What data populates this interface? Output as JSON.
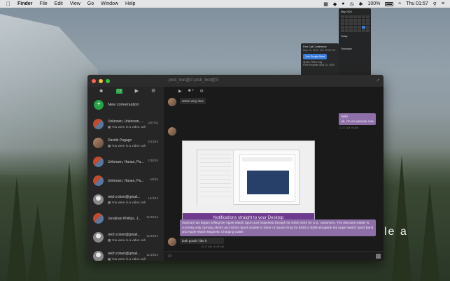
{
  "menubar": {
    "apple": "",
    "app_name": "Finder",
    "menus": [
      "File",
      "Edit",
      "View",
      "Go",
      "Window",
      "Help"
    ],
    "battery": "100%",
    "clock": "Thu 01:57"
  },
  "notification": {
    "title": "First Call Conference",
    "time": "May 22, 2020, 15 • 10:00 PM",
    "join_label": "Join Google Meet",
    "line1": "Sprint: Retro Day",
    "line2": "First Request: May 24, 2020"
  },
  "calendar": {
    "month": "May 2020",
    "today_label": "Today",
    "tomorrow_label": "Tomorrow"
  },
  "window": {
    "title": "pick_bot@3 pick_bot@3"
  },
  "sidebar": {
    "new_conversation": "New conversation",
    "conversations": [
      {
        "name": "Unknown, Unknown, ...",
        "sub": "You were in a video call",
        "time": "2/27/15"
      },
      {
        "name": "Davide Pagago",
        "sub": "You were in a video call",
        "time": "2/13/15"
      },
      {
        "name": "Unknown, Hanan, Pa...",
        "sub": "",
        "time": "1/30/15"
      },
      {
        "name": "Unknown, Hanan, Pa...",
        "sub": "",
        "time": "1/6/15"
      },
      {
        "name": "reich.robert@gmail...",
        "sub": "You were in a video call",
        "time": "12/4/14"
      },
      {
        "name": "Jonathan Phillips, J...",
        "sub": "",
        "time": "11/26/14"
      },
      {
        "name": "reich.robert@gmail...",
        "sub": "You were in a video call",
        "time": "11/20/14"
      },
      {
        "name": "reich.robert@gmail...",
        "sub": "You were in a video call",
        "time": "11/19/14"
      },
      {
        "name": "reich.robert@gmail...",
        "sub": "You were in a video call",
        "time": "11/18/14"
      }
    ]
  },
  "chat": {
    "msg1": "seem very nice",
    "msg2_line1": "hello",
    "msg2_line2": "ok, i'm on episode now",
    "msg2_time": "11:17 AM  05 AM",
    "attachment_caption": "Notifications straight to your Desktop",
    "long_msg": "Walmart has begun selling the Apple Watch Sport and requested through its online store for U.S. customers. The discount retailer is currently only carrying 38mm and 42mm Sport models in Silver or Space Gray for $349 to $399 alongside the Apple Watch Sport Band and Apple Watch Magnetic Charging Cable.",
    "msg_final": "look good! i like it",
    "msg_final_time": "11:17 AM  10:48 AM"
  },
  "overlay": {
    "text": "le a"
  }
}
